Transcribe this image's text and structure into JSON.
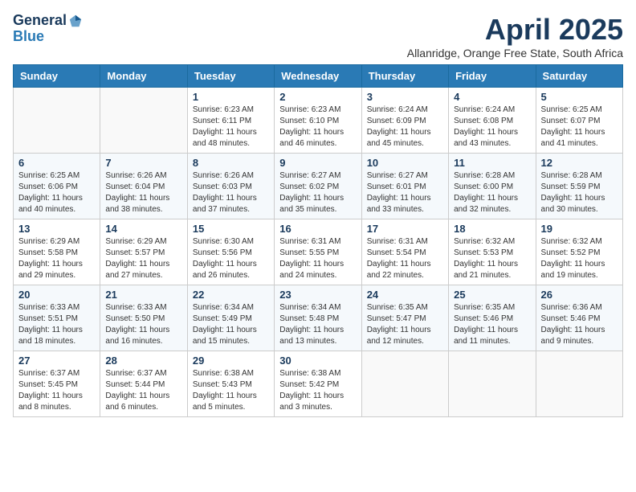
{
  "logo": {
    "line1": "General",
    "line2": "Blue"
  },
  "title": "April 2025",
  "subtitle": "Allanridge, Orange Free State, South Africa",
  "days_header": [
    "Sunday",
    "Monday",
    "Tuesday",
    "Wednesday",
    "Thursday",
    "Friday",
    "Saturday"
  ],
  "weeks": [
    [
      {
        "day": "",
        "info": ""
      },
      {
        "day": "",
        "info": ""
      },
      {
        "day": "1",
        "info": "Sunrise: 6:23 AM\nSunset: 6:11 PM\nDaylight: 11 hours and 48 minutes."
      },
      {
        "day": "2",
        "info": "Sunrise: 6:23 AM\nSunset: 6:10 PM\nDaylight: 11 hours and 46 minutes."
      },
      {
        "day": "3",
        "info": "Sunrise: 6:24 AM\nSunset: 6:09 PM\nDaylight: 11 hours and 45 minutes."
      },
      {
        "day": "4",
        "info": "Sunrise: 6:24 AM\nSunset: 6:08 PM\nDaylight: 11 hours and 43 minutes."
      },
      {
        "day": "5",
        "info": "Sunrise: 6:25 AM\nSunset: 6:07 PM\nDaylight: 11 hours and 41 minutes."
      }
    ],
    [
      {
        "day": "6",
        "info": "Sunrise: 6:25 AM\nSunset: 6:06 PM\nDaylight: 11 hours and 40 minutes."
      },
      {
        "day": "7",
        "info": "Sunrise: 6:26 AM\nSunset: 6:04 PM\nDaylight: 11 hours and 38 minutes."
      },
      {
        "day": "8",
        "info": "Sunrise: 6:26 AM\nSunset: 6:03 PM\nDaylight: 11 hours and 37 minutes."
      },
      {
        "day": "9",
        "info": "Sunrise: 6:27 AM\nSunset: 6:02 PM\nDaylight: 11 hours and 35 minutes."
      },
      {
        "day": "10",
        "info": "Sunrise: 6:27 AM\nSunset: 6:01 PM\nDaylight: 11 hours and 33 minutes."
      },
      {
        "day": "11",
        "info": "Sunrise: 6:28 AM\nSunset: 6:00 PM\nDaylight: 11 hours and 32 minutes."
      },
      {
        "day": "12",
        "info": "Sunrise: 6:28 AM\nSunset: 5:59 PM\nDaylight: 11 hours and 30 minutes."
      }
    ],
    [
      {
        "day": "13",
        "info": "Sunrise: 6:29 AM\nSunset: 5:58 PM\nDaylight: 11 hours and 29 minutes."
      },
      {
        "day": "14",
        "info": "Sunrise: 6:29 AM\nSunset: 5:57 PM\nDaylight: 11 hours and 27 minutes."
      },
      {
        "day": "15",
        "info": "Sunrise: 6:30 AM\nSunset: 5:56 PM\nDaylight: 11 hours and 26 minutes."
      },
      {
        "day": "16",
        "info": "Sunrise: 6:31 AM\nSunset: 5:55 PM\nDaylight: 11 hours and 24 minutes."
      },
      {
        "day": "17",
        "info": "Sunrise: 6:31 AM\nSunset: 5:54 PM\nDaylight: 11 hours and 22 minutes."
      },
      {
        "day": "18",
        "info": "Sunrise: 6:32 AM\nSunset: 5:53 PM\nDaylight: 11 hours and 21 minutes."
      },
      {
        "day": "19",
        "info": "Sunrise: 6:32 AM\nSunset: 5:52 PM\nDaylight: 11 hours and 19 minutes."
      }
    ],
    [
      {
        "day": "20",
        "info": "Sunrise: 6:33 AM\nSunset: 5:51 PM\nDaylight: 11 hours and 18 minutes."
      },
      {
        "day": "21",
        "info": "Sunrise: 6:33 AM\nSunset: 5:50 PM\nDaylight: 11 hours and 16 minutes."
      },
      {
        "day": "22",
        "info": "Sunrise: 6:34 AM\nSunset: 5:49 PM\nDaylight: 11 hours and 15 minutes."
      },
      {
        "day": "23",
        "info": "Sunrise: 6:34 AM\nSunset: 5:48 PM\nDaylight: 11 hours and 13 minutes."
      },
      {
        "day": "24",
        "info": "Sunrise: 6:35 AM\nSunset: 5:47 PM\nDaylight: 11 hours and 12 minutes."
      },
      {
        "day": "25",
        "info": "Sunrise: 6:35 AM\nSunset: 5:46 PM\nDaylight: 11 hours and 11 minutes."
      },
      {
        "day": "26",
        "info": "Sunrise: 6:36 AM\nSunset: 5:46 PM\nDaylight: 11 hours and 9 minutes."
      }
    ],
    [
      {
        "day": "27",
        "info": "Sunrise: 6:37 AM\nSunset: 5:45 PM\nDaylight: 11 hours and 8 minutes."
      },
      {
        "day": "28",
        "info": "Sunrise: 6:37 AM\nSunset: 5:44 PM\nDaylight: 11 hours and 6 minutes."
      },
      {
        "day": "29",
        "info": "Sunrise: 6:38 AM\nSunset: 5:43 PM\nDaylight: 11 hours and 5 minutes."
      },
      {
        "day": "30",
        "info": "Sunrise: 6:38 AM\nSunset: 5:42 PM\nDaylight: 11 hours and 3 minutes."
      },
      {
        "day": "",
        "info": ""
      },
      {
        "day": "",
        "info": ""
      },
      {
        "day": "",
        "info": ""
      }
    ]
  ]
}
